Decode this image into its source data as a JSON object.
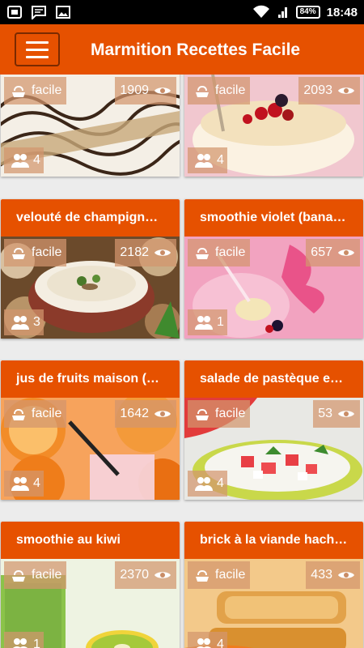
{
  "status": {
    "battery": "84%",
    "time": "18:48"
  },
  "app_title": "Marmition Recettes Facile",
  "cards": [
    {
      "title": "",
      "difficulty": "facile",
      "views": "1909",
      "people": "4"
    },
    {
      "title": "",
      "difficulty": "facile",
      "views": "2093",
      "people": "4"
    },
    {
      "title": "velouté de champign…",
      "difficulty": "facile",
      "views": "2182",
      "people": "3"
    },
    {
      "title": "smoothie violet (bana…",
      "difficulty": "facile",
      "views": "657",
      "people": "1"
    },
    {
      "title": "jus de fruits maison (…",
      "difficulty": "facile",
      "views": "1642",
      "people": "4"
    },
    {
      "title": "salade de pastèque e…",
      "difficulty": "facile",
      "views": "53",
      "people": "4"
    },
    {
      "title": "smoothie au kiwi",
      "difficulty": "facile",
      "views": "2370",
      "people": "1"
    },
    {
      "title": "brick à la viande hach…",
      "difficulty": "facile",
      "views": "433",
      "people": "4"
    }
  ],
  "colors": {
    "primary": "#e65100",
    "status_bar": "#000000",
    "pill": "rgba(210,150,110,0.72)"
  }
}
